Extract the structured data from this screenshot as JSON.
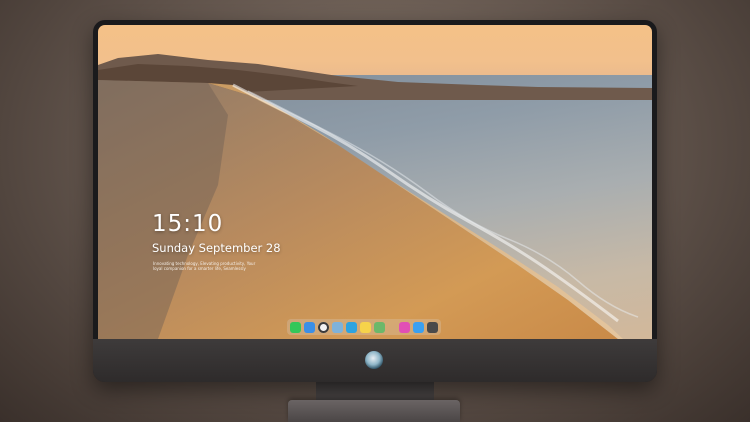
{
  "lock_screen": {
    "time": "15:10",
    "date": "Sunday September 28",
    "tagline": "Innovating technology, Elevating productivity, Your loyal companion for a smarter life, Seamlessly"
  },
  "dock": {
    "items": [
      {
        "name": "messages-icon",
        "color": "#34c759"
      },
      {
        "name": "finder-icon",
        "color": "#3b8fe6"
      },
      {
        "name": "safari-icon",
        "color": "#f2f2f2"
      },
      {
        "name": "preview-icon",
        "color": "#7fb2d9"
      },
      {
        "name": "clapper-icon",
        "color": "#2da3e0"
      },
      {
        "name": "notes-icon",
        "color": "#f6d34a"
      },
      {
        "name": "photos-icon",
        "color": "#6cb86a"
      },
      {
        "name": "itunes-icon",
        "color": "#e14fb5"
      },
      {
        "name": "app-store-icon",
        "color": "#3aa0f0"
      },
      {
        "name": "camera-icon",
        "color": "#4a4a4a"
      }
    ]
  },
  "colors": {
    "bezel": "#1a1a1c",
    "sky": "#f4c187",
    "sand": "#c98a48",
    "sea": "#8f9ca8"
  }
}
